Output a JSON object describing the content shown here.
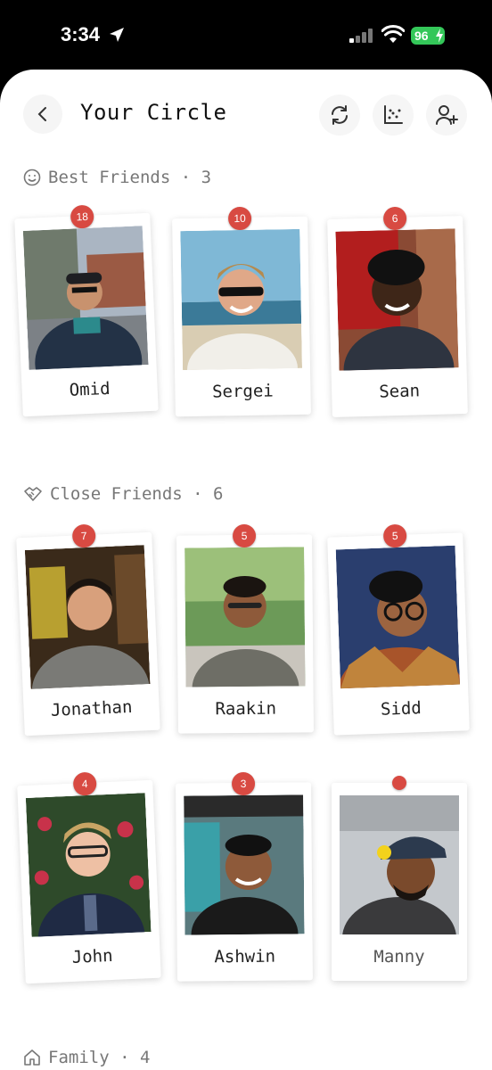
{
  "status_bar": {
    "time": "3:34",
    "battery": "96"
  },
  "header": {
    "title": "Your Circle"
  },
  "sections": [
    {
      "label": "Best Friends · 3",
      "friends": [
        {
          "name": "Omid",
          "badge": "18"
        },
        {
          "name": "Sergei",
          "badge": "10"
        },
        {
          "name": "Sean",
          "badge": "6"
        }
      ]
    },
    {
      "label": "Close Friends · 6",
      "friends": [
        {
          "name": "Jonathan",
          "badge": "7"
        },
        {
          "name": "Raakin",
          "badge": "5"
        },
        {
          "name": "Sidd",
          "badge": "5"
        },
        {
          "name": "John",
          "badge": "4"
        },
        {
          "name": "Ashwin",
          "badge": "3"
        },
        {
          "name": "Manny",
          "badge": ""
        }
      ]
    },
    {
      "label": "Family · 4",
      "friends": []
    }
  ],
  "colors": {
    "accent": "#d84a42",
    "battery": "#34c759"
  }
}
